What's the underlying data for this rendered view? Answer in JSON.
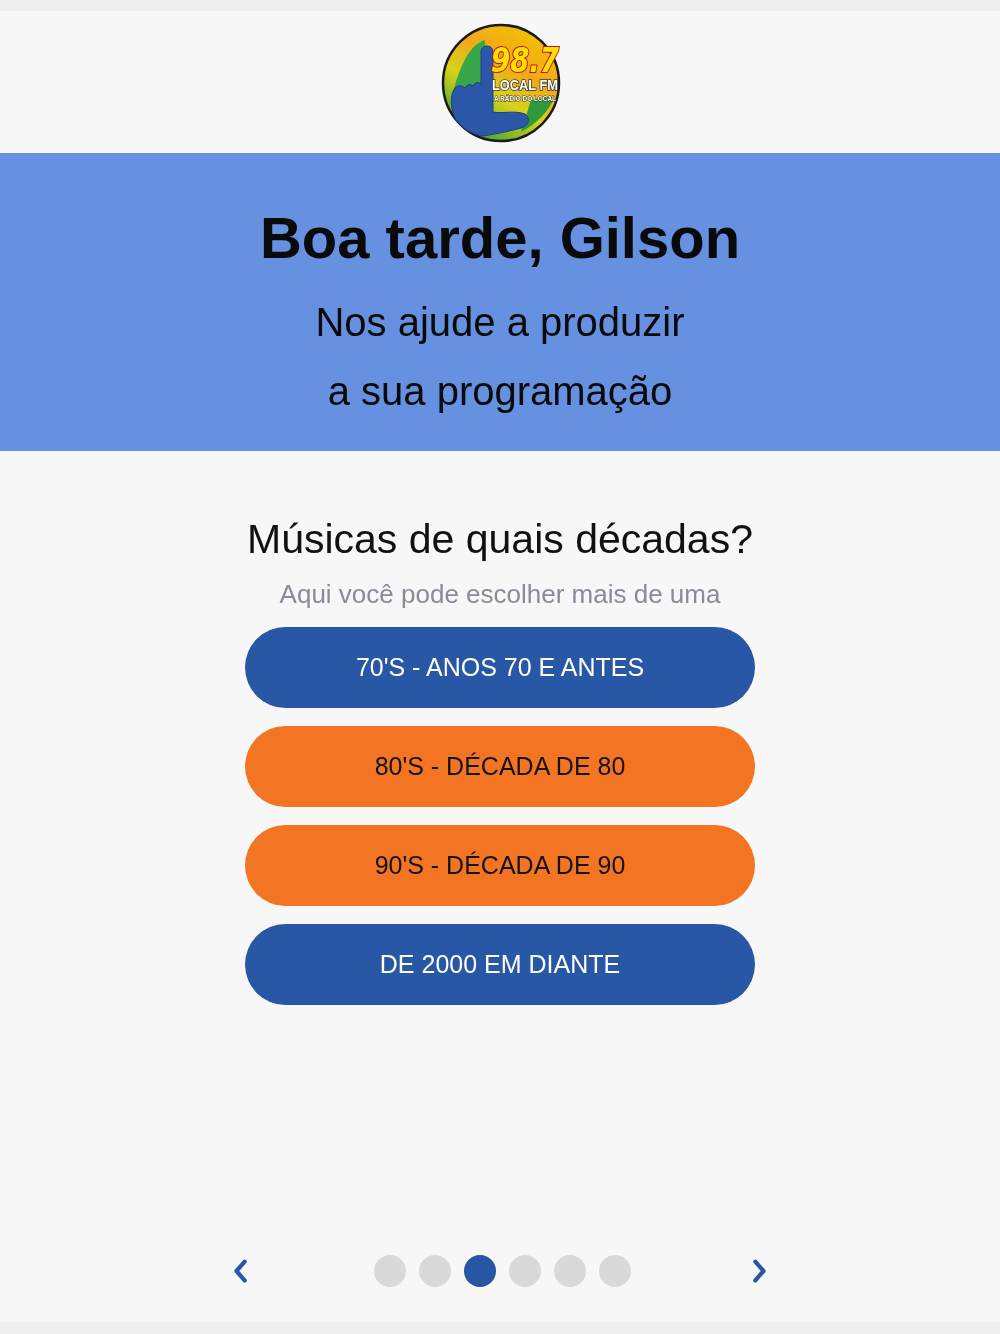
{
  "logo": {
    "frequency": "98.7",
    "name": "LOCAL FM",
    "slogan": "A RÁDIO DO LOCAL"
  },
  "banner": {
    "greeting": "Boa tarde, Gilson",
    "subtitle": "Nos ajude a produzir a sua programação"
  },
  "question": {
    "title": "Músicas de quais décadas?",
    "hint": "Aqui você pode escolher mais de uma"
  },
  "options": [
    {
      "label": "70'S - ANOS 70 E ANTES",
      "selected": false
    },
    {
      "label": "80'S - DÉCADA DE 80",
      "selected": true
    },
    {
      "label": "90'S - DÉCADA DE 90",
      "selected": true
    },
    {
      "label": "DE 2000 EM DIANTE",
      "selected": false
    }
  ],
  "pager": {
    "pages": [
      {
        "selected": false
      },
      {
        "selected": false
      },
      {
        "selected": true
      },
      {
        "selected": false
      },
      {
        "selected": false
      },
      {
        "selected": false
      }
    ]
  }
}
